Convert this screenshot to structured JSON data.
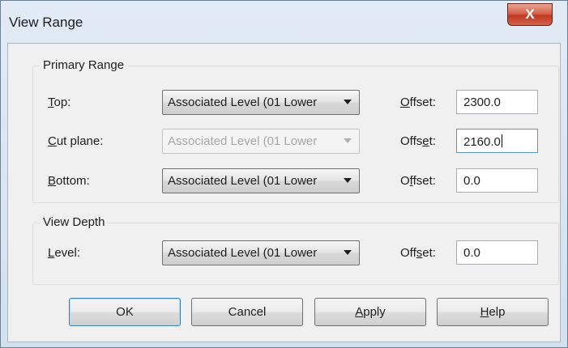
{
  "window": {
    "title": "View Range",
    "close_glyph": "X"
  },
  "primary_range": {
    "legend": "Primary Range",
    "rows": [
      {
        "label": "Top:",
        "mnemonic": "T",
        "label_rest": "op:",
        "combo_value": "Associated Level (01 Lower",
        "combo_enabled": true,
        "offset_label_pre": "",
        "offset_mnemonic": "O",
        "offset_label_post": "ffset:",
        "offset_value": "2300.0"
      },
      {
        "label": "Cut plane:",
        "mnemonic": "C",
        "label_rest": "ut plane:",
        "combo_value": "Associated Level (01 Lower",
        "combo_enabled": false,
        "offset_label_pre": "Offs",
        "offset_mnemonic": "e",
        "offset_label_post": "t:",
        "offset_value": "2160.0"
      },
      {
        "label": "Bottom:",
        "mnemonic": "B",
        "label_rest": "ottom:",
        "combo_value": "Associated Level (01 Lower",
        "combo_enabled": true,
        "offset_label_pre": "O",
        "offset_mnemonic": "f",
        "offset_label_post": "fset:",
        "offset_value": "0.0"
      }
    ]
  },
  "view_depth": {
    "legend": "View Depth",
    "row": {
      "label": "Level:",
      "mnemonic": "L",
      "label_rest": "evel:",
      "combo_value": "Associated Level (01 Lower",
      "offset_label_pre": "Off",
      "offset_mnemonic": "s",
      "offset_label_post": "et:",
      "offset_value": "0.0"
    }
  },
  "buttons": {
    "ok": "OK",
    "cancel": "Cancel",
    "apply_mnemonic": "A",
    "apply_rest": "pply",
    "help_mnemonic": "H",
    "help_rest": "elp"
  },
  "colors": {
    "close_button": "#c0391f",
    "focus_border": "#5b95d0",
    "default_button_border": "#3c7fb1"
  }
}
